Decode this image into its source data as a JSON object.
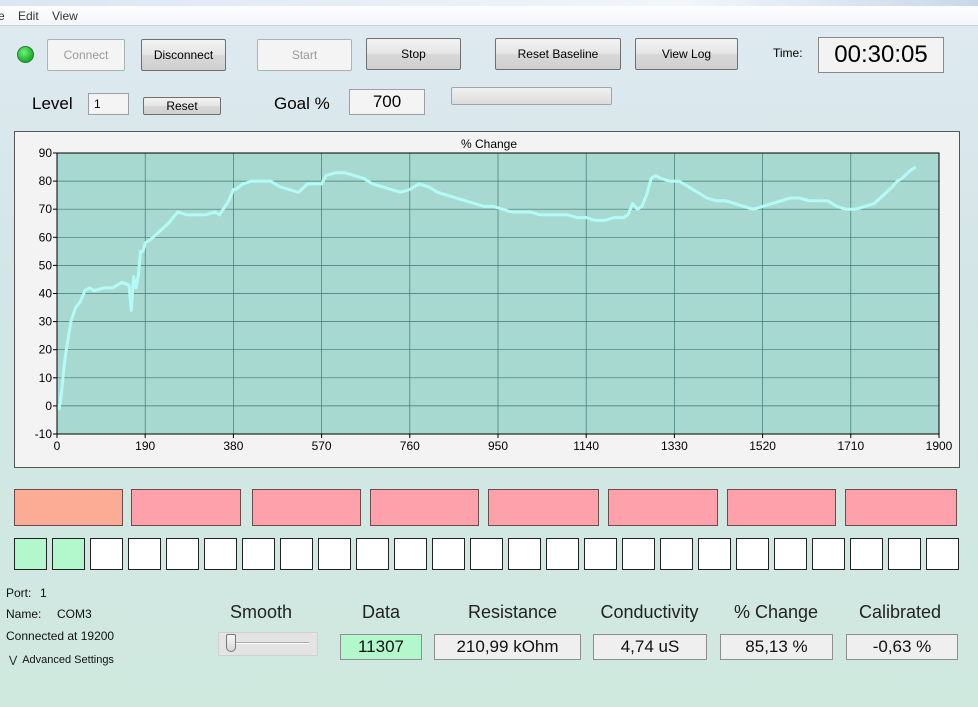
{
  "menu": {
    "items": [
      "e",
      "Edit",
      "View"
    ]
  },
  "toolbar": {
    "connect": "Connect",
    "disconnect": "Disconnect",
    "start": "Start",
    "stop": "Stop",
    "reset_baseline": "Reset Baseline",
    "view_log": "View Log",
    "time_label": "Time:",
    "time_value": "00:30:05"
  },
  "level": {
    "label": "Level",
    "value": "1",
    "reset": "Reset"
  },
  "goal": {
    "label": "Goal %",
    "value": "700",
    "progress": 0
  },
  "chart_data": {
    "type": "line",
    "title": "% Change",
    "xlabel": "",
    "ylabel": "",
    "xlim": [
      0,
      1900
    ],
    "ylim": [
      -10,
      90
    ],
    "xticks": [
      0,
      190,
      380,
      570,
      760,
      950,
      1140,
      1330,
      1520,
      1710,
      1900
    ],
    "yticks": [
      -10,
      0,
      10,
      20,
      30,
      40,
      50,
      60,
      70,
      80,
      90
    ],
    "grid": true,
    "line_color": "#b4fbf8",
    "plot_bg": "#a8d9d0",
    "series": [
      {
        "x": [
          0,
          5,
          10,
          15,
          20,
          25,
          30,
          40,
          50,
          60,
          70,
          80,
          100,
          120,
          140,
          155,
          160,
          165,
          170,
          175,
          180,
          185,
          190,
          200,
          220,
          240,
          260,
          280,
          300,
          320,
          340,
          350,
          370,
          380,
          385,
          400,
          420,
          440,
          460,
          480,
          500,
          520,
          540,
          560,
          570,
          580,
          600,
          620,
          640,
          660,
          680,
          700,
          720,
          740,
          760,
          770,
          780,
          800,
          820,
          840,
          860,
          880,
          900,
          920,
          940,
          960,
          980,
          1000,
          1020,
          1040,
          1060,
          1080,
          1100,
          1120,
          1140,
          1160,
          1180,
          1200,
          1220,
          1230,
          1240,
          1250,
          1260,
          1270,
          1280,
          1290,
          1300,
          1320,
          1340,
          1360,
          1380,
          1400,
          1420,
          1440,
          1460,
          1480,
          1500,
          1520,
          1540,
          1560,
          1580,
          1600,
          1620,
          1640,
          1660,
          1680,
          1700,
          1720,
          1740,
          1760,
          1780,
          1800,
          1810,
          1820,
          1840,
          1850
        ],
        "y": [
          0,
          -1,
          5,
          14,
          20,
          25,
          30,
          35,
          37,
          41,
          42,
          41,
          42,
          42,
          44,
          43,
          34,
          46,
          42,
          46,
          55,
          55,
          58,
          59,
          62,
          65,
          69,
          68,
          68,
          68,
          69,
          68,
          73,
          77,
          77,
          79,
          80,
          80,
          80,
          78,
          77,
          76,
          79,
          79,
          79,
          82,
          83,
          83,
          82,
          81,
          79,
          78,
          77,
          76,
          77,
          78,
          79,
          78,
          76,
          75,
          74,
          73,
          72,
          71,
          71,
          70,
          69,
          69,
          69,
          68,
          68,
          68,
          68,
          67,
          67,
          66,
          66,
          67,
          67,
          68,
          72,
          70,
          71,
          75,
          81,
          82,
          81,
          80,
          80,
          78,
          76,
          74,
          73,
          73,
          72,
          71,
          70,
          71,
          72,
          73,
          74,
          74,
          73,
          73,
          73,
          71,
          70,
          70,
          71,
          72,
          75,
          78,
          80,
          81,
          84,
          85
        ]
      }
    ]
  },
  "indicators": {
    "segments": [
      "orange",
      "pink",
      "pink",
      "pink",
      "pink",
      "pink",
      "pink",
      "pink"
    ],
    "squares": [
      true,
      true,
      false,
      false,
      false,
      false,
      false,
      false,
      false,
      false,
      false,
      false,
      false,
      false,
      false,
      false,
      false,
      false,
      false,
      false,
      false,
      false,
      false,
      false,
      false
    ]
  },
  "port_info": {
    "port_label": "Port:",
    "port_value": "1",
    "name_label": "Name:",
    "name_value": "COM3",
    "connected": "Connected at 19200",
    "advanced": "Advanced Settings"
  },
  "meters": {
    "smooth_title": "Smooth",
    "smooth_value": 0,
    "data_title": "Data",
    "data_value": "11307",
    "resistance_title": "Resistance",
    "resistance_value": "210,99 kOhm",
    "conductivity_title": "Conductivity",
    "conductivity_value": "4,74 uS",
    "change_title": "% Change",
    "change_value": "85,13 %",
    "calibrated_title": "Calibrated",
    "calibrated_value": "-0,63 %"
  }
}
